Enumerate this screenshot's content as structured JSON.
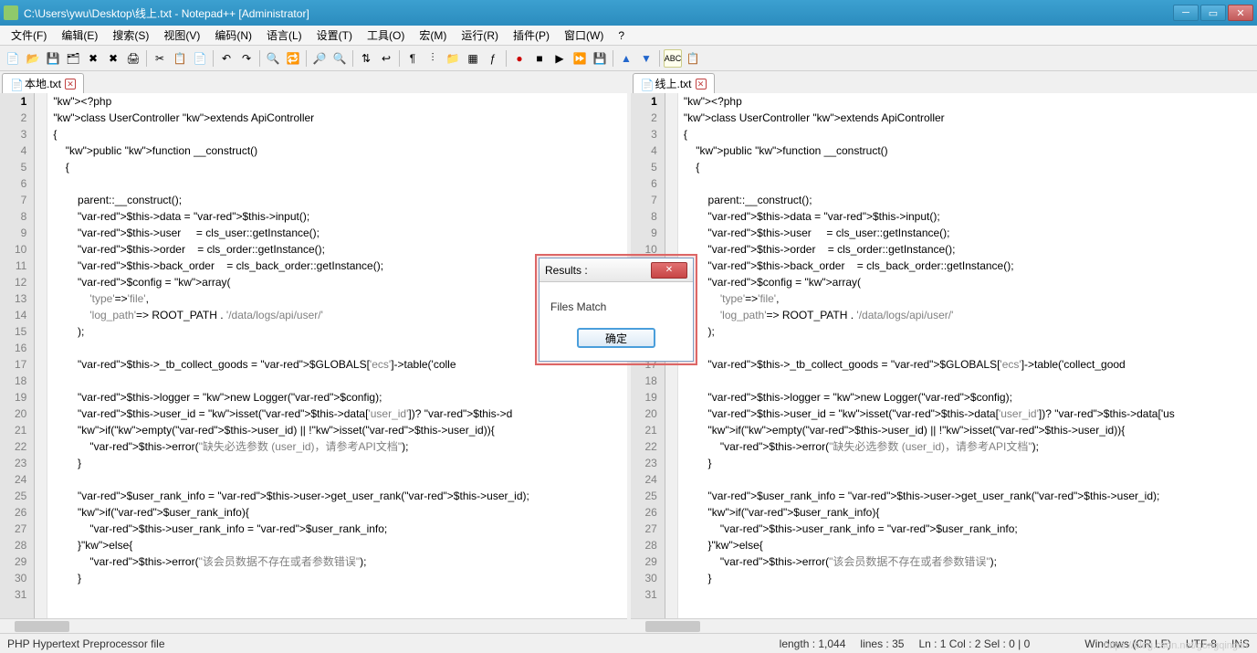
{
  "window": {
    "title": "C:\\Users\\ywu\\Desktop\\线上.txt - Notepad++ [Administrator]"
  },
  "menu": [
    "文件(F)",
    "编辑(E)",
    "搜索(S)",
    "视图(V)",
    "编码(N)",
    "语言(L)",
    "设置(T)",
    "工具(O)",
    "宏(M)",
    "运行(R)",
    "插件(P)",
    "窗口(W)",
    "?"
  ],
  "tabs": {
    "left": "本地.txt",
    "right": "线上.txt"
  },
  "code_left": [
    "<?php",
    "class UserController extends ApiController",
    "{",
    "    public function __construct()",
    "    {",
    "",
    "        parent::__construct();",
    "        $this->data = $this->input();",
    "        $this->user     = cls_user::getInstance();",
    "        $this->order    = cls_order::getInstance();",
    "        $this->back_order    = cls_back_order::getInstance();",
    "        $config = array(",
    "            'type'=>'file',",
    "            'log_path'=> ROOT_PATH . '/data/logs/api/user/'",
    "        );",
    "",
    "        $this->_tb_collect_goods = $GLOBALS['ecs']->table('colle",
    "",
    "        $this->logger = new Logger($config);",
    "        $this->user_id = isset($this->data['user_id'])? $this->d",
    "        if(empty($this->user_id) || !isset($this->user_id)){",
    "            $this->error(\"缺失必选参数 (user_id)，请参考API文档\");",
    "        }",
    "",
    "        $user_rank_info = $this->user->get_user_rank($this->user_id);",
    "        if($user_rank_info){",
    "            $this->user_rank_info = $user_rank_info;",
    "        }else{",
    "            $this->error(\"该会员数据不存在或者参数错误\");",
    "        }",
    ""
  ],
  "code_right": [
    "<?php",
    "class UserController extends ApiController",
    "{",
    "    public function __construct()",
    "    {",
    "",
    "        parent::__construct();",
    "        $this->data = $this->input();",
    "        $this->user     = cls_user::getInstance();",
    "        $this->order    = cls_order::getInstance();",
    "        $this->back_order    = cls_back_order::getInstance();",
    "        $config = array(",
    "            'type'=>'file',",
    "            'log_path'=> ROOT_PATH . '/data/logs/api/user/'",
    "        );",
    "",
    "        $this->_tb_collect_goods = $GLOBALS['ecs']->table('collect_good",
    "",
    "        $this->logger = new Logger($config);",
    "        $this->user_id = isset($this->data['user_id'])? $this->data['us",
    "        if(empty($this->user_id) || !isset($this->user_id)){",
    "            $this->error(\"缺失必选参数 (user_id)，请参考API文档\");",
    "        }",
    "",
    "        $user_rank_info = $this->user->get_user_rank($this->user_id);",
    "        if($user_rank_info){",
    "            $this->user_rank_info = $user_rank_info;",
    "        }else{",
    "            $this->error(\"该会员数据不存在或者参数错误\");",
    "        }",
    ""
  ],
  "dialog": {
    "title": "Results :",
    "message": "Files Match",
    "ok": "确定"
  },
  "status": {
    "filetype": "PHP Hypertext Preprocessor file",
    "length": "length : 1,044",
    "lines": "lines : 35",
    "pos": "Ln : 1    Col : 2    Sel : 0 | 0",
    "eol": "Windows (CR LF)",
    "enc": "UTF-8",
    "ins": "INS"
  },
  "watermark": "https://blog.csdn.net/gongqinglin"
}
